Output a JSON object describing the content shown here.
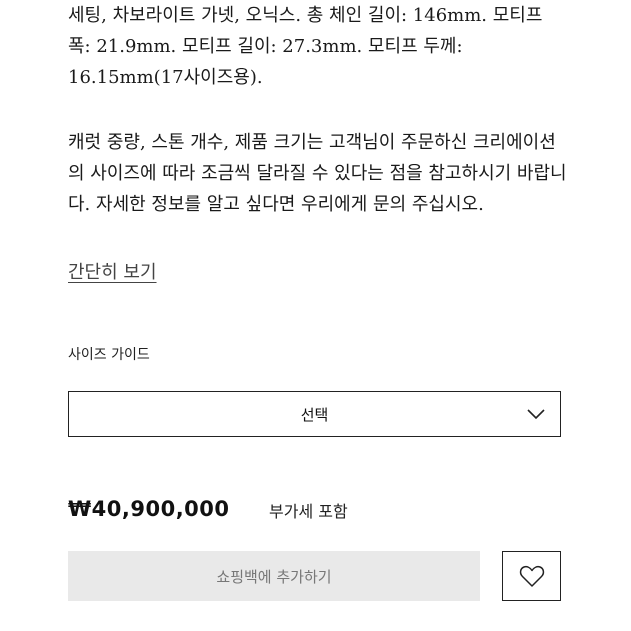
{
  "description": {
    "paragraph1": "세팅, 차보라이트 가넷, 오닉스. 총 체인 길이: 146mm. 모티프 폭: 21.9mm. 모티프 길이: 27.3mm. 모티프 두께: 16.15mm(17사이즈용).",
    "paragraph2": "캐럿 중량, 스톤 개수, 제품 크기는 고객님이 주문하신 크리에이션의 사이즈에 따라 조금씩 달라질 수 있다는 점을 참고하시기 바랍니다. 자세한 정보를 알고 싶다면 우리에게 문의 주십시오."
  },
  "collapse_link": "간단히 보기",
  "size_guide": {
    "label": "사이즈 가이드",
    "selected": "선택",
    "icon": "chevron-down-icon"
  },
  "price": {
    "amount": "₩40,900,000",
    "vat_note": "부가세 포함"
  },
  "actions": {
    "add_to_cart": "쇼핑백에 추가하기",
    "wishlist_icon": "heart-icon"
  }
}
